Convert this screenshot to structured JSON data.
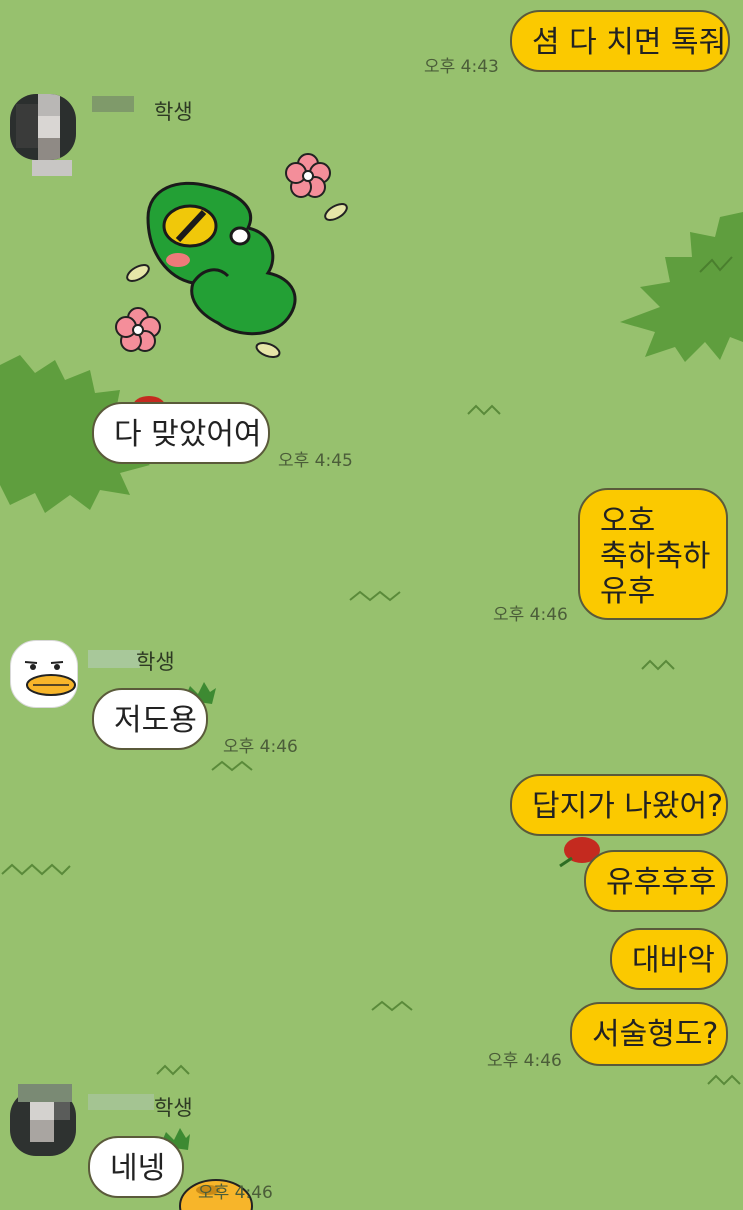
{
  "messages": [
    {
      "side": "me",
      "text": "셤 다 치면 톡줘",
      "time": "오후 4:43"
    },
    {
      "side": "other",
      "sender": "학생",
      "type": "sticker",
      "sticker": "green-dinosaur-sticker"
    },
    {
      "side": "other",
      "text": "다 맞았어여",
      "time": "오후 4:45"
    },
    {
      "side": "me",
      "lines": [
        "오호",
        "축하축하",
        "유후"
      ],
      "time": "오후 4:46"
    },
    {
      "side": "other",
      "sender": "학생",
      "text": "저도용",
      "time": "오후 4:46"
    },
    {
      "side": "me",
      "text": "답지가 나왔어?"
    },
    {
      "side": "me",
      "text": "유후후후"
    },
    {
      "side": "me",
      "text": "대바악"
    },
    {
      "side": "me",
      "text": "서술형도?",
      "time": "오후 4:46"
    },
    {
      "side": "other",
      "sender": "학생",
      "text": "네넹",
      "time": "오후 4:46"
    }
  ],
  "colors": {
    "background": "#97c16e",
    "my_bubble": "#fbc900",
    "other_bubble": "#ffffff",
    "bush": "#5f9e3e"
  }
}
